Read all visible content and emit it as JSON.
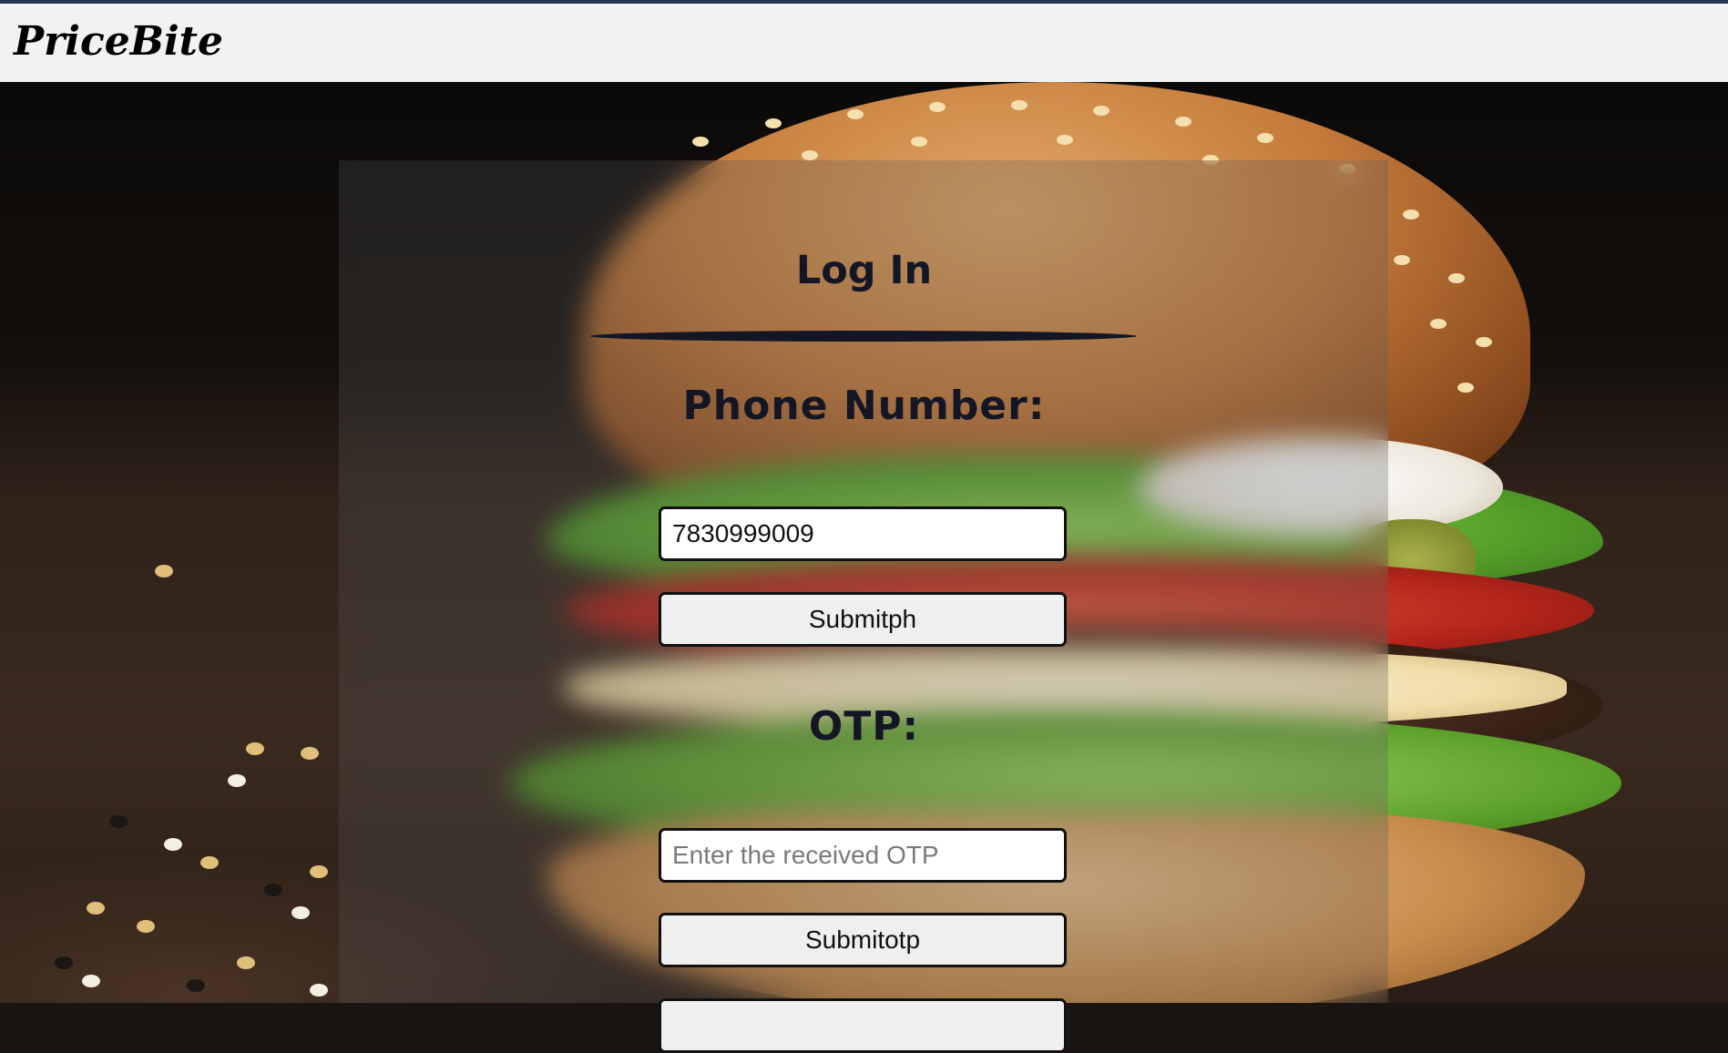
{
  "header": {
    "brand": "PriceBite"
  },
  "login": {
    "title": "Log In",
    "phone_label": "Phone Number:",
    "phone_value": "7830999009",
    "submit_phone_label": "Submitph",
    "otp_label": "OTP:",
    "otp_placeholder": "Enter the received OTP",
    "submit_otp_label": "Submitotp"
  },
  "colors": {
    "header_bg": "#f2f2f2",
    "top_border": "#24364f",
    "heading_text": "#141625",
    "button_bg": "#efefef"
  }
}
